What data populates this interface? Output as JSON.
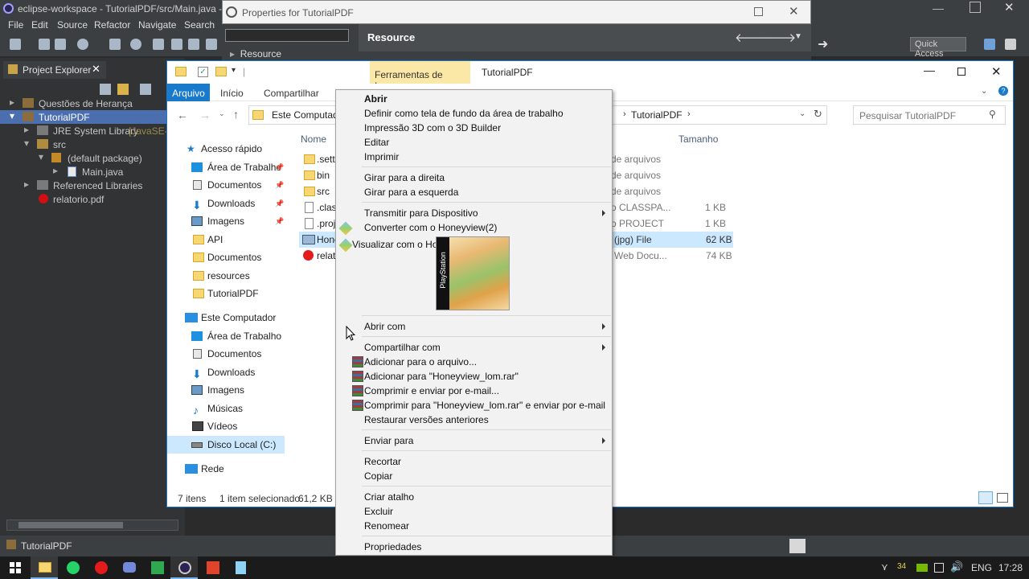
{
  "eclipse": {
    "title": "eclipse-workspace - TutorialPDF/src/Main.java - E",
    "menu": [
      "File",
      "Edit",
      "Source",
      "Refactor",
      "Navigate",
      "Search"
    ],
    "quick_access": "Quick Access",
    "project_explorer_tab": "Project Explorer",
    "tree": [
      {
        "label": "Questões de Herança"
      },
      {
        "label": "TutorialPDF"
      },
      {
        "label": "JRE System Library",
        "suffix": "[JavaSE-1"
      },
      {
        "label": "src"
      },
      {
        "label": "(default package)"
      },
      {
        "label": "Main.java"
      },
      {
        "label": "Referenced Libraries"
      },
      {
        "label": "relatorio.pdf"
      }
    ],
    "status_project": "TutorialPDF"
  },
  "properties_dialog": {
    "title": "Properties for TutorialPDF",
    "tree_item": "Resource",
    "header": "Resource"
  },
  "explorer": {
    "tools_tab": "Ferramentas de Imagem",
    "window_title": "TutorialPDF",
    "tabs": [
      "Arquivo",
      "Início",
      "Compartilhar"
    ],
    "address_start": "Este Computad",
    "address_end": "TutorialPDF",
    "search_placeholder": "Pesquisar TutorialPDF",
    "nav": {
      "quick_access": "Acesso rápido",
      "quick_items": [
        "Área de Trabalho",
        "Documentos",
        "Downloads",
        "Imagens",
        "API",
        "Documentos",
        "resources",
        "TutorialPDF"
      ],
      "this_pc": "Este Computador",
      "pc_items": [
        "Área de Trabalho",
        "Documentos",
        "Downloads",
        "Imagens",
        "Músicas",
        "Vídeos",
        "Disco Local (C:)"
      ],
      "network": "Rede"
    },
    "columns": {
      "name": "Nome",
      "size": "Tamanho"
    },
    "files": [
      {
        "name": ".setti",
        "type": "de arquivos",
        "size": ""
      },
      {
        "name": "bin",
        "type": "de arquivos",
        "size": ""
      },
      {
        "name": "src",
        "type": "de arquivos",
        "size": ""
      },
      {
        "name": ".class",
        "type": "o CLASSPA...",
        "size": "1 KB"
      },
      {
        "name": ".proj",
        "type": "o PROJECT",
        "size": "1 KB"
      },
      {
        "name": "Hone",
        "type": "(jpg) File",
        "size": "62 KB"
      },
      {
        "name": "relat",
        "type": "Web Docu...",
        "size": "74 KB"
      }
    ],
    "status": {
      "count": "7 itens",
      "selection": "1 item selecionado",
      "size": "61,2 KB"
    }
  },
  "context_menu": {
    "items": [
      {
        "label": "Abrir",
        "bold": true
      },
      {
        "label": "Definir como tela de fundo da área de trabalho"
      },
      {
        "label": "Impressão 3D com o 3D Builder"
      },
      {
        "label": "Editar"
      },
      {
        "label": "Imprimir"
      },
      {
        "label": "Girar para a direita"
      },
      {
        "label": "Girar para a esquerda"
      },
      {
        "label": "Transmitir para Dispositivo"
      },
      {
        "label": "Converter com o Honeyview(2)"
      },
      {
        "label": "Visualizar com o Honeyview(3)"
      },
      {
        "label": "Abrir com"
      },
      {
        "label": "Compartilhar com"
      },
      {
        "label": "Adicionar para o arquivo..."
      },
      {
        "label": "Adicionar para \"Honeyview_lom.rar\""
      },
      {
        "label": "Comprimir e enviar por e-mail..."
      },
      {
        "label": "Comprimir para \"Honeyview_lom.rar\" e enviar por e-mail"
      },
      {
        "label": "Restaurar versões anteriores"
      },
      {
        "label": "Enviar para"
      },
      {
        "label": "Recortar"
      },
      {
        "label": "Copiar"
      },
      {
        "label": "Criar atalho"
      },
      {
        "label": "Excluir"
      },
      {
        "label": "Renomear"
      },
      {
        "label": "Propriedades"
      }
    ],
    "preview_side_text": "PlayStation"
  },
  "taskbar": {
    "battery_text": "34",
    "language": "ENG",
    "clock": "17:28"
  }
}
